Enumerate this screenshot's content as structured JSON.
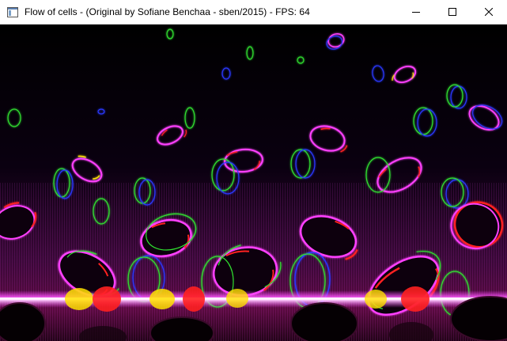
{
  "window": {
    "title": "Flow of cells - (Original by Sofiane Benchaa - sben/2015) - FPS: 64",
    "icons": {
      "app": "app-window-icon",
      "minimize": "minimize-icon",
      "maximize": "maximize-icon",
      "close": "close-icon"
    }
  },
  "scene": {
    "background_top": "#000000",
    "background_bottom": "#5a0a40",
    "colors": {
      "red": "#ff2020",
      "green": "#30e030",
      "blue": "#2a38ff",
      "magenta": "#ff40ff",
      "yellow": "#ffe000",
      "white": "#ffffff"
    }
  }
}
